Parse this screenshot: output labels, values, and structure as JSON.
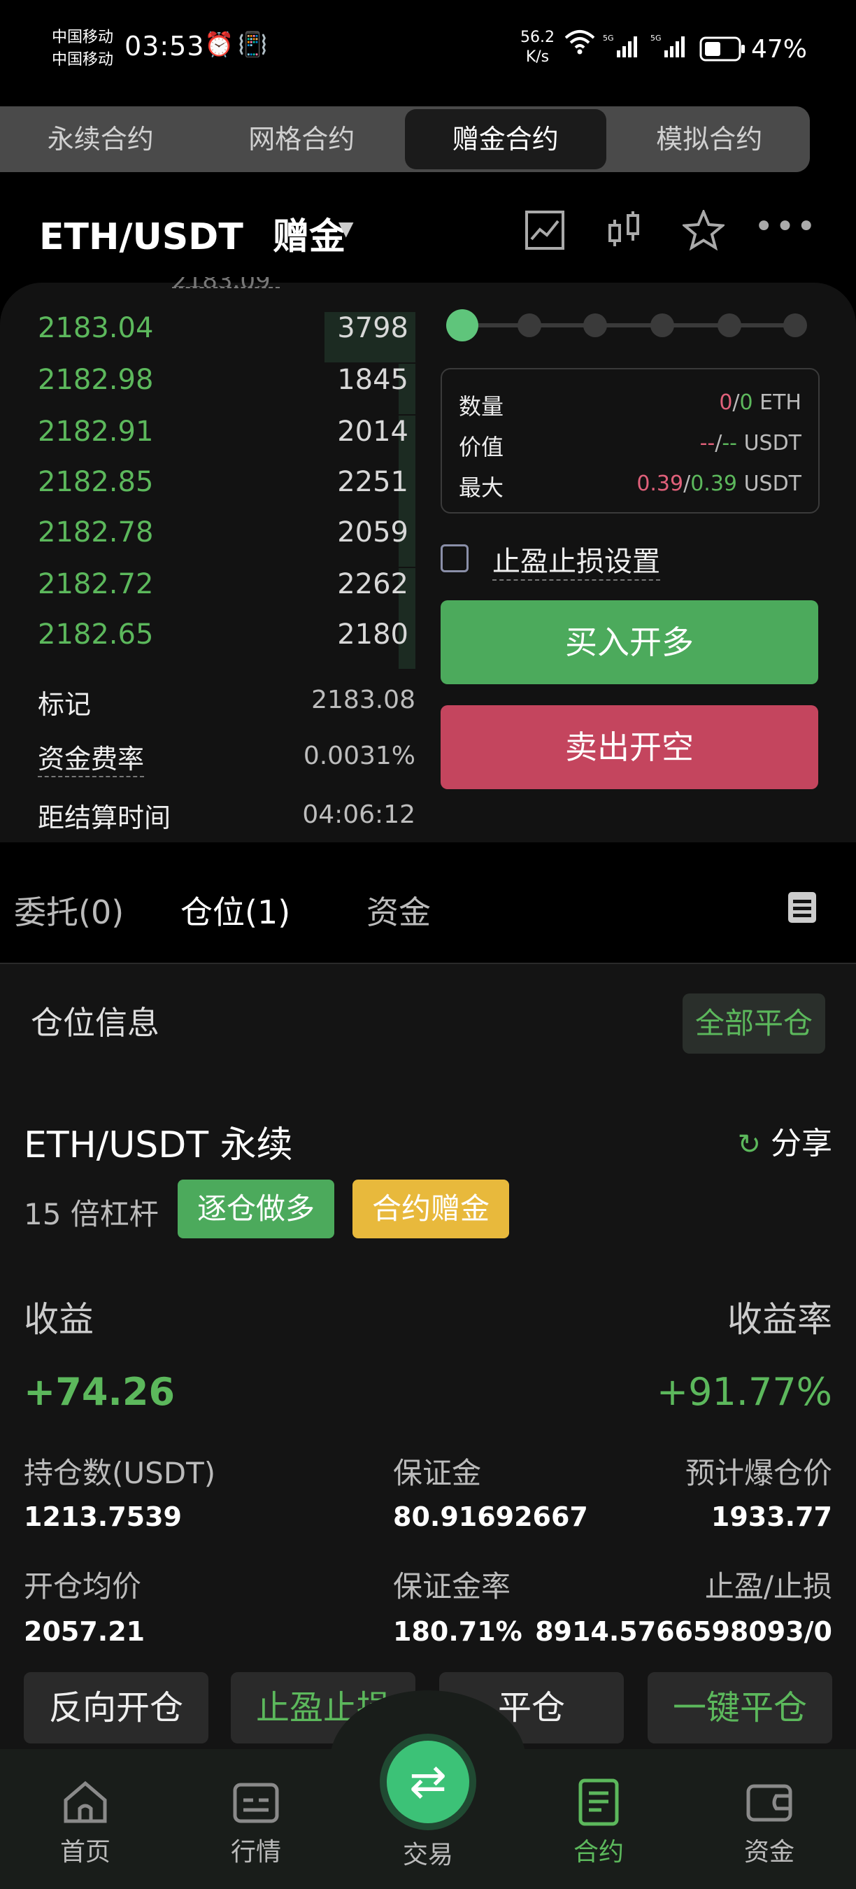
{
  "status_bar": {
    "carrier1": "中国移动",
    "carrier2": "中国移动",
    "time": "03:53",
    "speed": "56.2\nK/s",
    "speed_val": "56.2",
    "speed_unit": "K/s",
    "battery": "47%"
  },
  "tabs": [
    "永续合约",
    "网格合约",
    "赠金合约",
    "模拟合约"
  ],
  "active_tab": "赠金合约",
  "pair": {
    "symbol": "ETH/USDT",
    "badge": "赠金"
  },
  "orderbook": [
    {
      "price": "2183.04",
      "qty": "3798"
    },
    {
      "price": "2182.98",
      "qty": "1845"
    },
    {
      "price": "2182.91",
      "qty": "2014"
    },
    {
      "price": "2182.85",
      "qty": "2251"
    },
    {
      "price": "2182.78",
      "qty": "2059"
    },
    {
      "price": "2182.72",
      "qty": "2262"
    },
    {
      "price": "2182.65",
      "qty": "2180"
    }
  ],
  "info": {
    "mark_label": "标记",
    "mark_value": "2183.08",
    "funding_label": "资金费率",
    "funding_value": "0.0031%",
    "settle_label": "距结算时间",
    "settle_value": "04:06:12"
  },
  "order_form": {
    "qty_label": "数量",
    "qty_a": "0",
    "qty_b": "0",
    "qty_unit": "ETH",
    "value_label": "价值",
    "value_a": "--",
    "value_b": "--",
    "value_unit": "USDT",
    "max_label": "最大",
    "max_a": "0.39",
    "max_b": "0.39",
    "max_unit": "USDT",
    "tpsl_label": "止盈止损设置",
    "buy_label": "买入开多",
    "sell_label": "卖出开空"
  },
  "position_tabs": [
    "委托(0)",
    "仓位(1)",
    "资金"
  ],
  "position": {
    "section_title": "仓位信息",
    "close_all": "全部平仓",
    "title": "ETH/USDT 永续",
    "share": "分享",
    "leverage": "15 倍杠杆",
    "tag1": "逐仓做多",
    "tag2": "合约赠金",
    "pnl_label": "收益",
    "pnl_rate_label": "收益率",
    "pnl": "+74.26",
    "pnl_rate": "+91.77%",
    "hold_label": "持仓数(USDT)",
    "hold_value": "1213.7539",
    "margin_label": "保证金",
    "margin_value": "80.91692667",
    "liq_label": "预计爆仓价",
    "liq_value": "1933.77",
    "avg_label": "开仓均价",
    "avg_value": "2057.21",
    "margin_rate_label": "保证金率",
    "margin_rate_value": "180.71%",
    "tpsl_label": "止盈/止损",
    "tpsl_value": "8914.5766598093/0"
  },
  "actions": [
    "反向开仓",
    "止盈止损",
    "平仓",
    "一键平仓"
  ],
  "nav": [
    "首页",
    "行情",
    "交易",
    "合约",
    "资金"
  ],
  "colors": {
    "green": "#5cb85c",
    "red": "#c4455e",
    "yellow": "#e8b93c"
  }
}
